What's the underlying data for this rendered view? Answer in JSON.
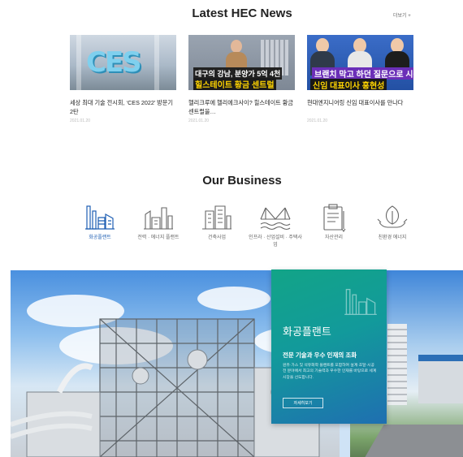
{
  "news": {
    "title": "Latest HEC News",
    "more": "더보기 +",
    "items": [
      {
        "title": "세상 최대 기술 전시회, ‘CES 2022’ 방문기 2탄",
        "date": "2021.01.20",
        "thumb_text": [
          "CES"
        ]
      },
      {
        "title": "헬리크루에 헬리에크사이? 힐스테이트 황금 센트럴을…",
        "date": "2021.01.20",
        "thumb_text": [
          "대구의 강남, 분양가 5억 4천",
          "힐스테이트 황금 센트럴"
        ]
      },
      {
        "title": "현대엔지니어링 신임 대표이사를 만나다",
        "date": "2021.01.20",
        "thumb_text": [
          "브랜치 막고 하던 질문으로 시작",
          "신임 대표이사",
          "홍현성"
        ]
      }
    ]
  },
  "business": {
    "title": "Our Business",
    "items": [
      {
        "label": "화공플랜트",
        "icon": "chemical-plant-icon",
        "active": true
      },
      {
        "label": "전력 · 에너지 플랜트",
        "icon": "power-plant-icon",
        "active": false
      },
      {
        "label": "건축사업",
        "icon": "building-icon",
        "active": false
      },
      {
        "label": "인프라 · 산업설비 · 주택사업",
        "icon": "bridge-icon",
        "active": false
      },
      {
        "label": "자산관리",
        "icon": "asset-clipboard-icon",
        "active": false
      },
      {
        "label": "친환경 에너지",
        "icon": "eco-energy-icon",
        "active": false
      }
    ]
  },
  "hero": {
    "title": "화공플랜트",
    "subtitle": "전문 기술과 우수 인재의 조화",
    "description": "원유·가스 및 석유화학 플랜트를 포함하여 설계·조달·시공 전 분야에서 최고의 기술력과 우수한 인재를 바탕으로 세계 시장을 선도합니다.",
    "button_label": "자세히보기"
  },
  "colors": {
    "accent_blue": "#1f5fb3",
    "panel_green": "#12a487",
    "panel_blue": "#1f6fb1"
  }
}
